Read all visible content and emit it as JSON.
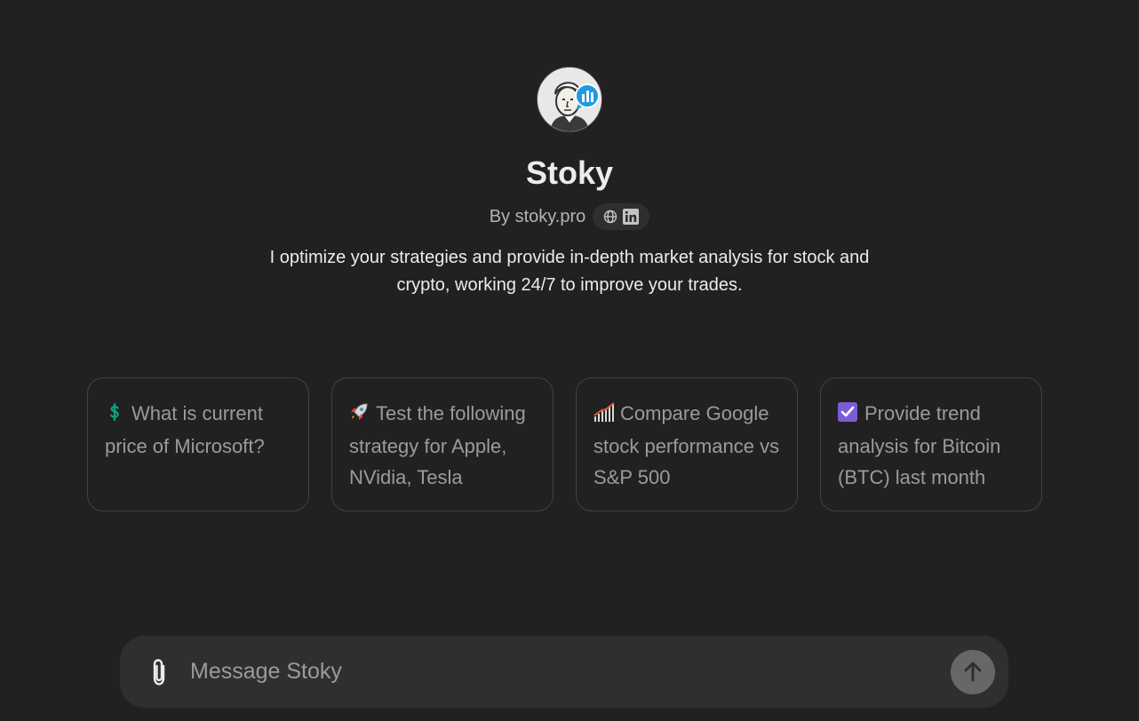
{
  "gpt": {
    "name": "Stoky",
    "byline": "By stoky.pro",
    "description": "I optimize your strategies and provide in-depth market analysis for stock and crypto, working 24/7 to improve your trades.",
    "avatar_icon": "trader-avatar-icon",
    "links": [
      "globe-icon",
      "linkedin-icon"
    ]
  },
  "starters": [
    {
      "icon": "dollar-sign-icon",
      "glyph": "$",
      "icon_color": "#10a37f",
      "text": "What is current price of Microsoft?"
    },
    {
      "icon": "rocket-icon",
      "glyph": "🚀",
      "icon_color": "#c4c4c4",
      "text": "Test the following strategy for Apple, NVidia, Tesla"
    },
    {
      "icon": "chart-bars-icon",
      "glyph": "bars",
      "icon_color": "#e05a3a",
      "text": "Compare Google stock performance vs S&P 500"
    },
    {
      "icon": "checkbox-icon",
      "glyph": "✔",
      "icon_color": "#7b5cd6",
      "text": "Provide trend analysis for Bitcoin (BTC) last month"
    }
  ],
  "composer": {
    "placeholder": "Message Stoky",
    "attach_icon": "paperclip-icon",
    "send_icon": "arrow-up-icon"
  },
  "colors": {
    "background": "#212121",
    "composer": "#2f2f2f",
    "card_border": "#424242",
    "send_button": "#676767"
  }
}
